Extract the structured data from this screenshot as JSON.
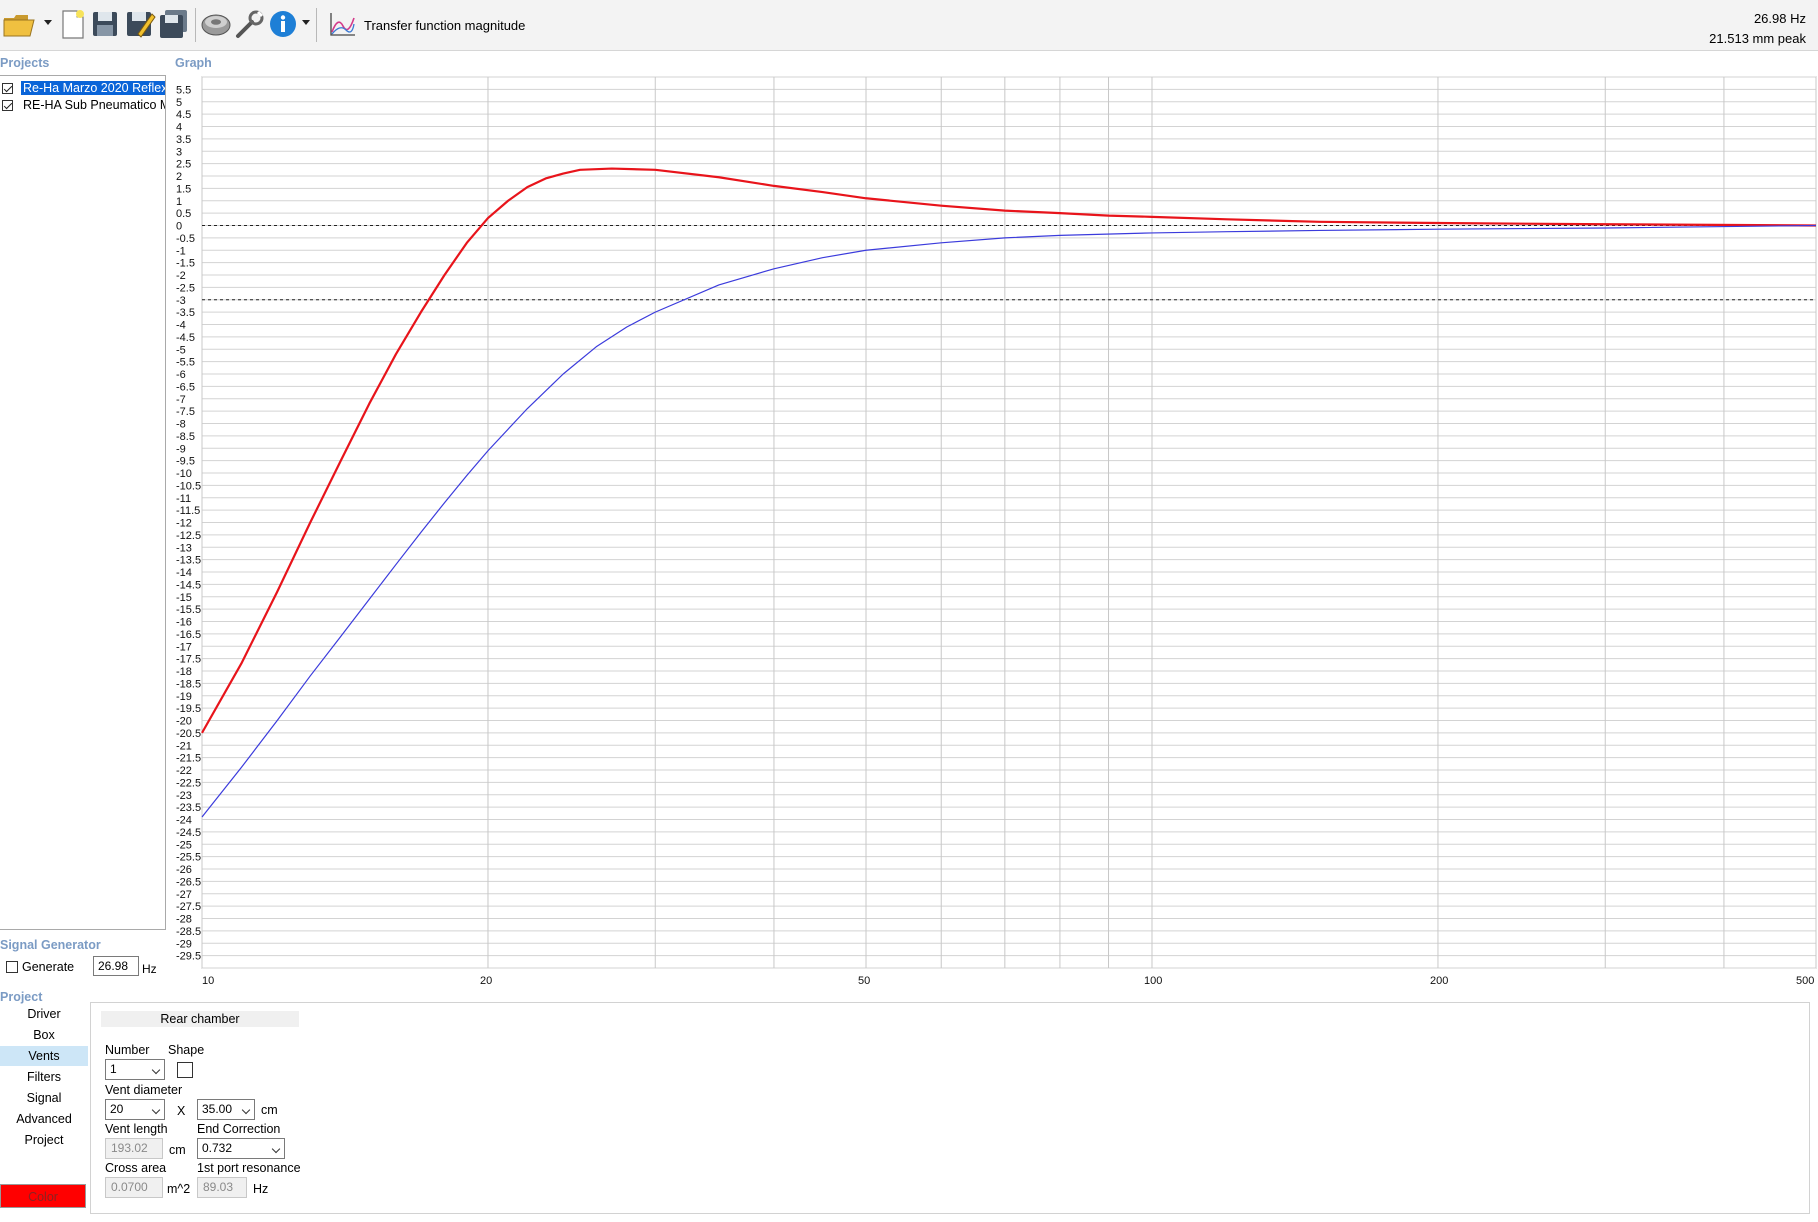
{
  "toolbar": {
    "icons": [
      "open-folder-icon",
      "new-project-icon",
      "save-icon",
      "save-as-icon",
      "save-all-icon",
      "driver-icon",
      "tools-icon",
      "info-icon",
      "graph-type-icon"
    ],
    "view_label": "Transfer function magnitude",
    "readout_freq": "26.98 Hz",
    "readout_excursion": "21.513 mm peak"
  },
  "sections": {
    "projects": "Projects",
    "graph": "Graph",
    "signal_generator": "Signal Generator",
    "project": "Project"
  },
  "projects": [
    {
      "name": "Re-Ha Marzo 2020 Reflex",
      "checked": true,
      "selected": true,
      "color": "#e8141b"
    },
    {
      "name": "RE-HA Sub Pneumatico Ma",
      "checked": true,
      "selected": false,
      "color": "#3b3bdc"
    }
  ],
  "signal_generator": {
    "generate_label": "Generate",
    "generate_checked": false,
    "frequency": "26.98",
    "unit": "Hz"
  },
  "nav": {
    "items": [
      "Driver",
      "Box",
      "Vents",
      "Filters",
      "Signal",
      "Advanced",
      "Project"
    ],
    "active": "Vents",
    "color_label": "Color"
  },
  "vents_panel": {
    "header": "Rear chamber",
    "number_label": "Number",
    "number_value": "1",
    "shape_label": "Shape",
    "diameter_label": "Vent diameter",
    "diameter_value": "20",
    "x_label": "X",
    "second_dim_value": "35.00",
    "dim_unit": "cm",
    "length_label": "Vent length",
    "length_value": "193.02",
    "length_unit": "cm",
    "end_correction_label": "End Correction",
    "end_correction_value": "0.732",
    "cross_area_label": "Cross area",
    "cross_area_value": "0.0700",
    "cross_area_unit": "m^2",
    "port_resonance_label": "1st port resonance",
    "port_resonance_value": "89.03",
    "port_resonance_unit": "Hz"
  },
  "chart_data": {
    "type": "line",
    "xscale": "log",
    "xlim": [
      10,
      500
    ],
    "ylim": [
      -30,
      6
    ],
    "x_tick_labels": [
      10,
      20,
      50,
      100,
      200,
      500
    ],
    "y_tick_step": 0.5,
    "reference_lines": [
      0,
      -3
    ],
    "grid": true,
    "series": [
      {
        "color": "#e8141b",
        "points": [
          [
            10,
            -20.5
          ],
          [
            11,
            -17.7
          ],
          [
            12,
            -14.8
          ],
          [
            13,
            -12.0
          ],
          [
            14,
            -9.5
          ],
          [
            15,
            -7.2
          ],
          [
            16,
            -5.2
          ],
          [
            17,
            -3.5
          ],
          [
            18,
            -2.0
          ],
          [
            19,
            -0.7
          ],
          [
            20,
            0.3
          ],
          [
            21,
            1.0
          ],
          [
            22,
            1.55
          ],
          [
            23,
            1.9
          ],
          [
            24,
            2.1
          ],
          [
            25,
            2.25
          ],
          [
            27,
            2.3
          ],
          [
            30,
            2.25
          ],
          [
            35,
            1.95
          ],
          [
            40,
            1.6
          ],
          [
            45,
            1.35
          ],
          [
            50,
            1.1
          ],
          [
            60,
            0.8
          ],
          [
            70,
            0.6
          ],
          [
            80,
            0.5
          ],
          [
            90,
            0.4
          ],
          [
            100,
            0.35
          ],
          [
            120,
            0.25
          ],
          [
            150,
            0.15
          ],
          [
            200,
            0.1
          ],
          [
            300,
            0.05
          ],
          [
            500,
            0.0
          ]
        ]
      },
      {
        "color": "#3b3bdc",
        "points": [
          [
            10,
            -23.9
          ],
          [
            11,
            -21.9
          ],
          [
            12,
            -20.0
          ],
          [
            13,
            -18.2
          ],
          [
            14,
            -16.6
          ],
          [
            15,
            -15.1
          ],
          [
            16,
            -13.7
          ],
          [
            17,
            -12.4
          ],
          [
            18,
            -11.2
          ],
          [
            19,
            -10.1
          ],
          [
            20,
            -9.1
          ],
          [
            22,
            -7.4
          ],
          [
            24,
            -6.0
          ],
          [
            26,
            -4.9
          ],
          [
            28,
            -4.1
          ],
          [
            30,
            -3.5
          ],
          [
            35,
            -2.4
          ],
          [
            40,
            -1.75
          ],
          [
            45,
            -1.3
          ],
          [
            50,
            -1.0
          ],
          [
            60,
            -0.7
          ],
          [
            70,
            -0.5
          ],
          [
            80,
            -0.4
          ],
          [
            100,
            -0.3
          ],
          [
            120,
            -0.25
          ],
          [
            150,
            -0.2
          ],
          [
            200,
            -0.15
          ],
          [
            300,
            -0.1
          ],
          [
            500,
            0.0
          ]
        ]
      }
    ]
  }
}
